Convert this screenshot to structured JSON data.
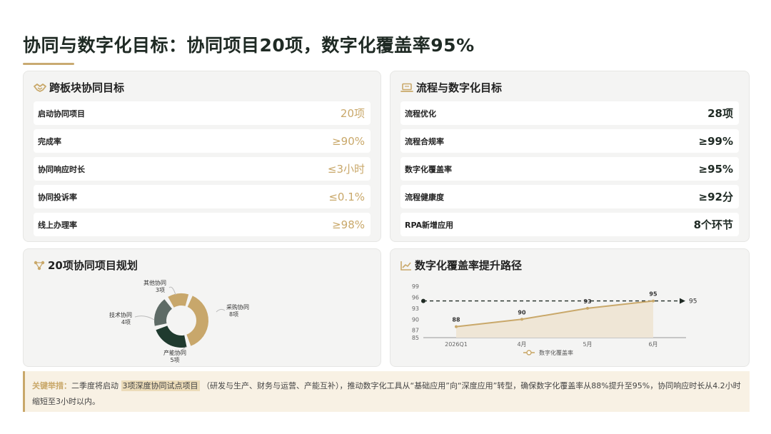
{
  "title": "协同与数字化目标：协同项目20项，数字化覆盖率95%",
  "colors": {
    "gold": "#c9a86a",
    "dark_green": "#1f3a2e",
    "slate": "#5e6b66",
    "tan": "#c8a76b"
  },
  "left_card": {
    "icon": "handshake-icon",
    "title": "跨板块协同目标",
    "rows": [
      {
        "label": "启动协同项目",
        "value": "20项"
      },
      {
        "label": "完成率",
        "value": "≥90%"
      },
      {
        "label": "协同响应时长",
        "value": "≤3小时"
      },
      {
        "label": "协同投诉率",
        "value": "≤0.1%"
      },
      {
        "label": "线上办理率",
        "value": "≥98%"
      }
    ]
  },
  "right_card": {
    "icon": "laptop-icon",
    "title": "流程与数字化目标",
    "rows": [
      {
        "label": "流程优化",
        "value": "28项"
      },
      {
        "label": "流程合规率",
        "value": "≥99%"
      },
      {
        "label": "数字化覆盖率",
        "value": "≥95%"
      },
      {
        "label": "流程健康度",
        "value": "≥92分"
      },
      {
        "label": "RPA新增应用",
        "value": "8个环节"
      }
    ]
  },
  "donut_card": {
    "icon": "network-icon",
    "title": "20项协同项目规划",
    "chart_data": {
      "type": "pie",
      "donut": true,
      "slices": [
        {
          "name": "采购协同",
          "sub": "8项",
          "value": 8,
          "color": "#c8a76b"
        },
        {
          "name": "产能协同",
          "sub": "5项",
          "value": 5,
          "color": "#1f3a2e"
        },
        {
          "name": "技术协同",
          "sub": "4项",
          "value": 4,
          "color": "#5e6b66"
        },
        {
          "name": "其他协同",
          "sub": "3项",
          "value": 3,
          "color": "#c8a76b"
        }
      ]
    }
  },
  "line_card": {
    "icon": "trend-icon",
    "title": "数字化覆盖率提升路径",
    "chart_data": {
      "type": "area",
      "categories": [
        "2026Q1",
        "4月",
        "5月",
        "6月"
      ],
      "series": [
        {
          "name": "数字化覆盖率",
          "values": [
            88,
            90,
            93,
            95
          ]
        }
      ],
      "yticks": [
        "85",
        "87",
        "90",
        "93",
        "96",
        "99"
      ],
      "ylim": [
        85,
        99
      ],
      "target": {
        "value": 95,
        "label": "95"
      },
      "legend": "bottom",
      "grid": false
    }
  },
  "note": {
    "keyword": "关键举措：",
    "text1": "二季度将启动",
    "highlight": "3项深度协同试点项目",
    "text2": "（研发与生产、财务与运营、产能互补），推动数字化工具从“基础应用”向“深度应用”转型，确保数字化覆盖率从88%提升至95%，协同响应时长从4.2小时缩短至3小时以内。"
  }
}
